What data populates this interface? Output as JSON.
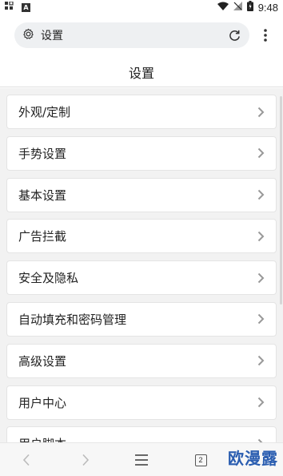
{
  "status_bar": {
    "time": "9:48",
    "app_badge": "A"
  },
  "toolbar": {
    "address_text": "设置",
    "settings_icon": "gear-icon",
    "reload_icon": "reload-icon",
    "more_icon": "more-vertical-icon"
  },
  "page": {
    "title": "设置"
  },
  "menu": {
    "items": [
      {
        "label": "外观/定制"
      },
      {
        "label": "手势设置"
      },
      {
        "label": "基本设置"
      },
      {
        "label": "广告拦截"
      },
      {
        "label": "安全及隐私"
      },
      {
        "label": "自动填充和密码管理"
      },
      {
        "label": "高级设置"
      },
      {
        "label": "用户中心"
      },
      {
        "label": "用户脚本"
      }
    ]
  },
  "bottom_nav": {
    "tab_count": "2"
  },
  "watermark": {
    "text": "欧漫露"
  },
  "colors": {
    "background": "#f2f2f2",
    "card": "#ffffff",
    "watermark": "#2a5db0"
  }
}
